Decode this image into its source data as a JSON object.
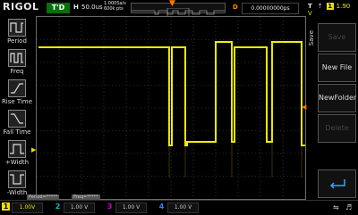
{
  "topbar": {
    "brand": "RIGOL",
    "run_status": "T'D",
    "horizontal_badge": "H",
    "timebase": "50.0us",
    "sample_rate": "1.000Sa/s",
    "memory_depth": "600k pts",
    "delay_badge": "D",
    "delay": "0.00000000ps",
    "trigger_type": "T",
    "trigger_edge_icon": "rising-edge-icon",
    "trigger_channel": "1",
    "trigger_level": "1.90 V"
  },
  "left_menu": {
    "items": [
      {
        "label": "Period",
        "icon": "period-icon"
      },
      {
        "label": "Freq",
        "icon": "freq-icon"
      },
      {
        "label": "Rise Time",
        "icon": "rise-time-icon"
      },
      {
        "label": "Fall Time",
        "icon": "fall-time-icon"
      },
      {
        "label": "+Width",
        "icon": "pos-width-icon"
      },
      {
        "label": "-Width",
        "icon": "neg-width-icon"
      }
    ]
  },
  "measure_status": {
    "period": "Period=*****",
    "freq": "Freq=*****"
  },
  "right_menu": {
    "title": "Save",
    "buttons": [
      {
        "label": "Save",
        "enabled": false
      },
      {
        "label": "New File",
        "enabled": true
      },
      {
        "label": "NewFolder",
        "enabled": true
      },
      {
        "label": "Delete",
        "enabled": false
      },
      {
        "label": "",
        "icon": "enter-icon",
        "enabled": true
      }
    ]
  },
  "channels": [
    {
      "num": "1",
      "scale": "1.00V",
      "color": "#f0e000",
      "active": true
    },
    {
      "num": "2",
      "scale": "1.00 V",
      "color": "#00c0c0",
      "active": false
    },
    {
      "num": "3",
      "scale": "1.00 V",
      "color": "#d000d0",
      "active": false
    },
    {
      "num": "4",
      "scale": "1.00 V",
      "color": "#3080ff",
      "active": false
    }
  ],
  "usb_icon": "usb-icon",
  "speaker_icon": "speaker-icon",
  "colors": {
    "trace": "#f0f000",
    "trigger": "#ff8c00",
    "run_status_bg": "#0a6e0a",
    "grid": "#5a5a5a"
  }
}
